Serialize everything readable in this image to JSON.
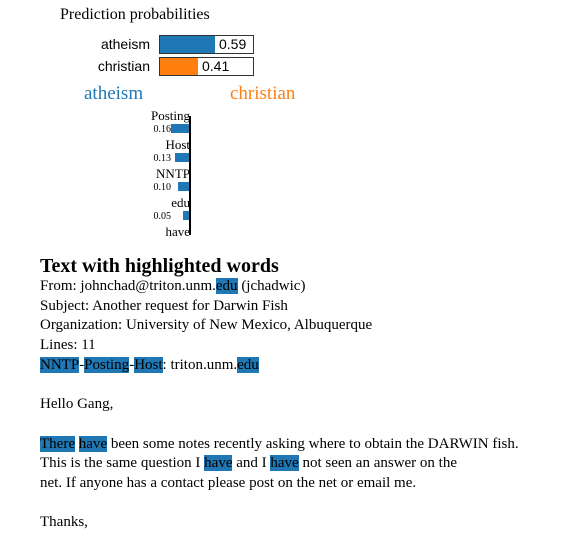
{
  "prediction": {
    "title": "Prediction probabilities",
    "classes": [
      {
        "label": "atheism",
        "value": "0.59",
        "fraction": 0.59,
        "color": "#1f77b4"
      },
      {
        "label": "christian",
        "value": "0.41",
        "fraction": 0.41,
        "color": "#ff7f0e"
      }
    ]
  },
  "class_labels": {
    "negative": {
      "label": "atheism",
      "color": "#1f77b4"
    },
    "positive": {
      "label": "christian",
      "color": "#ff7f0e"
    }
  },
  "chart_data": {
    "type": "bar",
    "orientation": "horizontal",
    "categories": [
      "Posting",
      "Host",
      "NNTP",
      "edu",
      "have"
    ],
    "values": [
      0.16,
      0.13,
      0.1,
      0.05,
      null
    ],
    "value_labels": [
      "0.16",
      "0.13",
      "0.10",
      "0.05",
      ""
    ],
    "series": [
      {
        "values": [
          0.16,
          0.13,
          0.1,
          0.05,
          null
        ],
        "color": "#1f77b4"
      }
    ],
    "direction": "atheism"
  },
  "text_section": {
    "title": "Text with highlighted words",
    "highlight_color": "#1f77b4",
    "lines": [
      [
        {
          "t": "From: johnchad@triton.unm."
        },
        {
          "t": "edu",
          "h": true
        },
        {
          "t": " (jchadwic)"
        }
      ],
      [
        {
          "t": "Subject: Another request for Darwin Fish"
        }
      ],
      [
        {
          "t": "Organization: University of New Mexico, Albuquerque"
        }
      ],
      [
        {
          "t": "Lines: 11"
        }
      ],
      [
        {
          "t": "NNTP",
          "h": true
        },
        {
          "t": "-"
        },
        {
          "t": "Posting",
          "h": true
        },
        {
          "t": "-"
        },
        {
          "t": "Host",
          "h": true
        },
        {
          "t": ": triton.unm."
        },
        {
          "t": "edu",
          "h": true
        }
      ],
      [
        {
          "t": ""
        }
      ],
      [
        {
          "t": "Hello Gang,"
        }
      ],
      [
        {
          "t": ""
        }
      ],
      [
        {
          "t": "There",
          "h": true
        },
        {
          "t": " "
        },
        {
          "t": "have",
          "h": true
        },
        {
          "t": " been some notes recently asking where to obtain the DARWIN fish."
        }
      ],
      [
        {
          "t": "This is the same question I "
        },
        {
          "t": "have",
          "h": true
        },
        {
          "t": " and I "
        },
        {
          "t": "have",
          "h": true
        },
        {
          "t": " not seen an answer on the"
        }
      ],
      [
        {
          "t": "net. If anyone has a contact please post on the net or email me."
        }
      ],
      [
        {
          "t": ""
        }
      ],
      [
        {
          "t": "Thanks,"
        }
      ]
    ]
  }
}
